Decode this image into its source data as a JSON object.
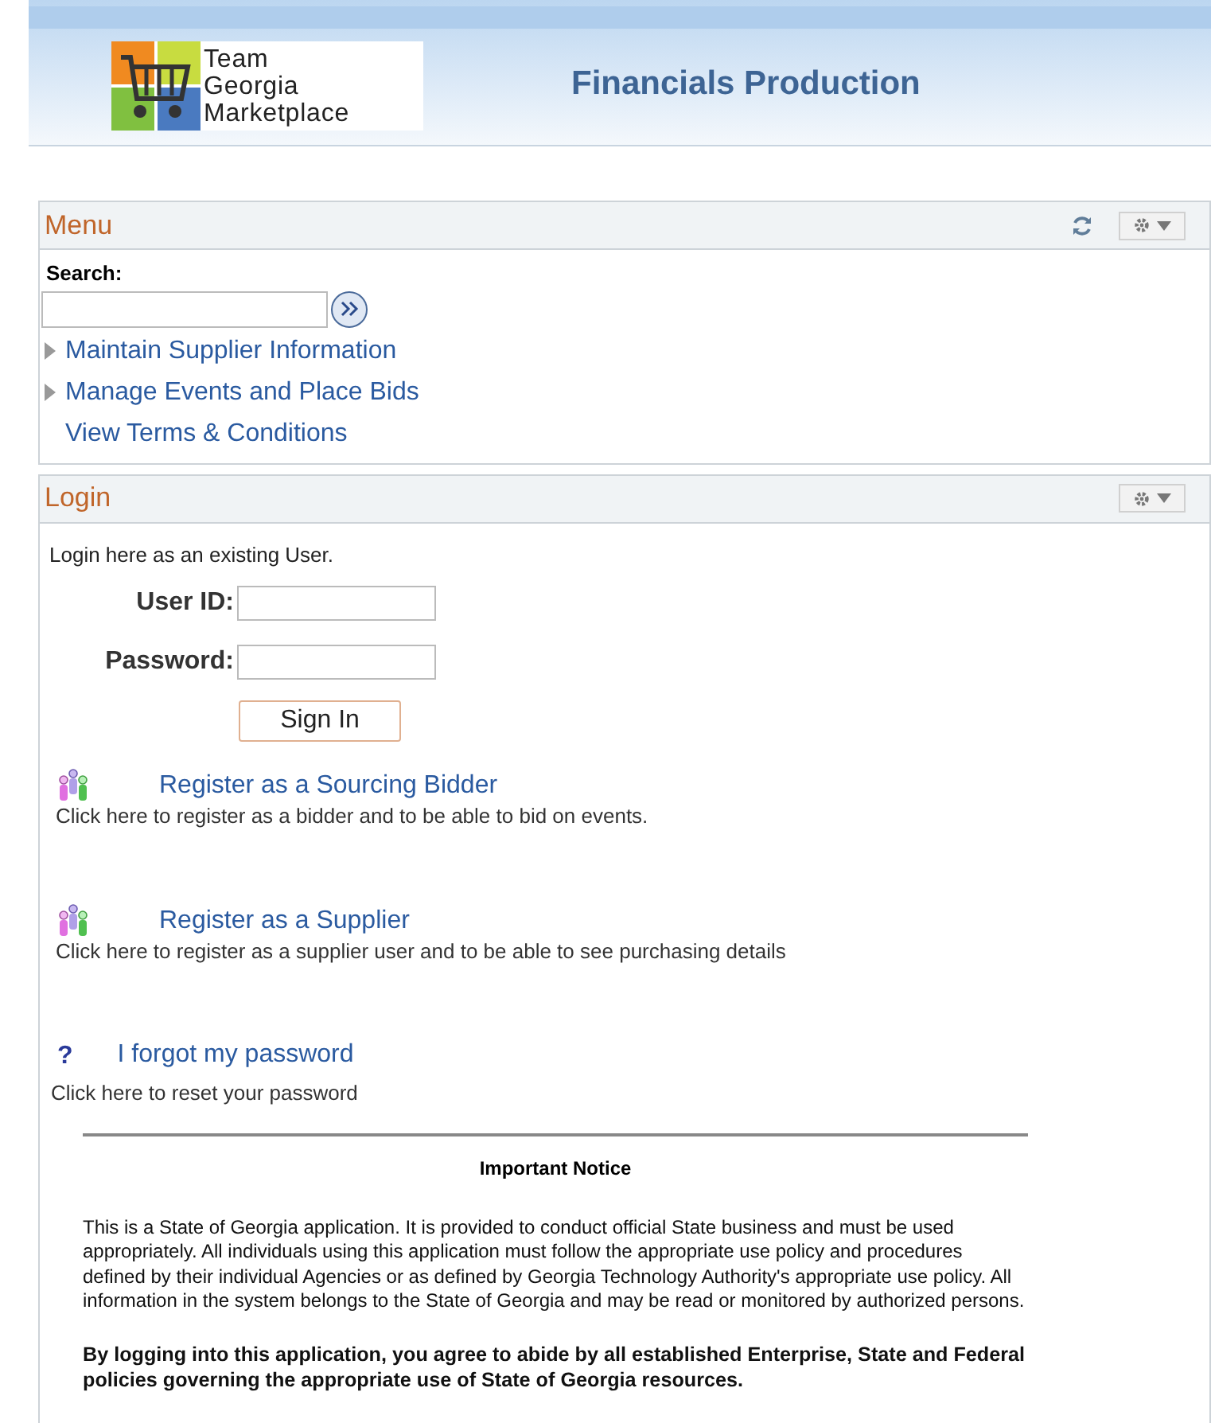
{
  "header": {
    "logo_lines": [
      "Team",
      "Georgia",
      "Marketplace"
    ],
    "title": "Financials Production"
  },
  "menu": {
    "title": "Menu",
    "search_label": "Search:",
    "items": [
      {
        "kind": "folder",
        "label": "Maintain Supplier Information"
      },
      {
        "kind": "folder",
        "label": "Manage Events and Place Bids"
      },
      {
        "kind": "link",
        "label": "View Terms & Conditions"
      }
    ]
  },
  "login": {
    "title": "Login",
    "intro": "Login here as an existing User.",
    "fields": [
      {
        "label": "User ID:"
      },
      {
        "label": "Password:"
      }
    ],
    "sign_in": "Sign In",
    "links": [
      {
        "kind": "register",
        "label": "Register as a Sourcing Bidder",
        "description": "Click here to register as a bidder and to be able to bid on events."
      },
      {
        "kind": "register",
        "label": "Register as a Supplier",
        "description": "Click here to register as a supplier user and to be able to see purchasing details"
      },
      {
        "kind": "help",
        "icon_text": "?",
        "label": "I forgot my password",
        "description": "Click here to reset your password"
      }
    ],
    "notice": {
      "title": "Important Notice",
      "paragraphs": [
        {
          "kind": "plain",
          "text": "This is a State of Georgia application. It is provided to conduct official State business and must be used appropriately. All individuals using this application must follow the appropriate use policy and procedures defined by their individual Agencies or as defined by Georgia Technology Authority's appropriate use policy. All information in the system belongs to the State of Georgia and may be read or monitored by authorized persons."
        },
        {
          "kind": "bold",
          "text": "By logging into this application, you agree to abide by all established Enterprise, State and Federal policies governing the appropriate use of State of Georgia resources."
        }
      ]
    }
  }
}
